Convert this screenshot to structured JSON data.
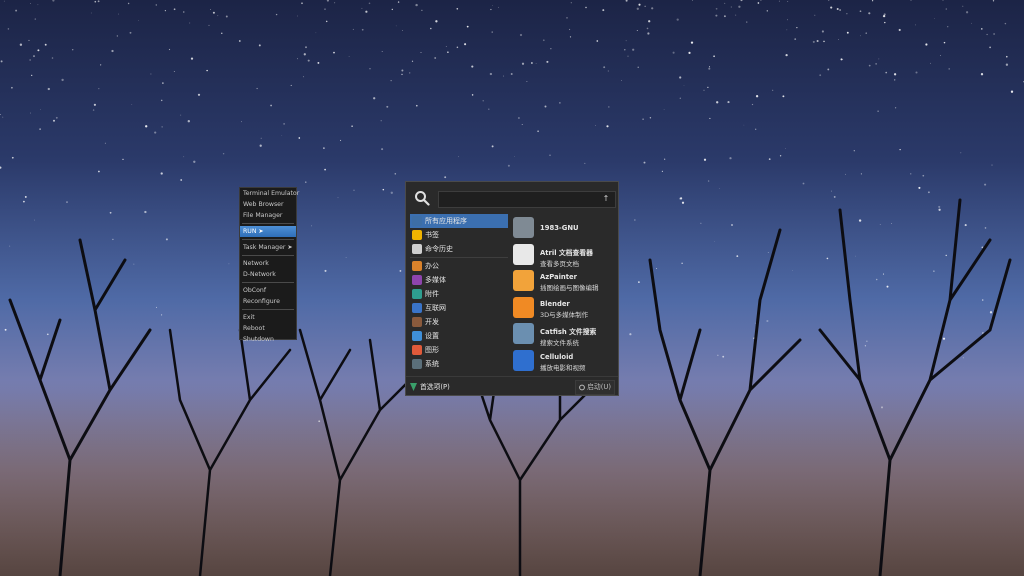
{
  "openbox_menu": {
    "items": [
      {
        "label": "Terminal Emulator"
      },
      {
        "label": "Web Browser"
      },
      {
        "label": "File Manager"
      },
      {
        "sep": true
      },
      {
        "label": "RUN ➤",
        "active": true
      },
      {
        "sep": true
      },
      {
        "label": "Task Manager ➤"
      },
      {
        "sep": true
      },
      {
        "label": "Network"
      },
      {
        "label": "D-Network"
      },
      {
        "sep": true
      },
      {
        "label": "ObConf"
      },
      {
        "label": "Reconfigure"
      },
      {
        "sep": true
      },
      {
        "label": "Exit"
      },
      {
        "label": "Reboot"
      },
      {
        "label": "Shutdown"
      }
    ]
  },
  "app_menu": {
    "search": {
      "value": "",
      "placeholder": "",
      "clear_icon": "clear-icon"
    },
    "categories": [
      {
        "label": "所有应用程序",
        "icon": "all-apps-icon",
        "color": "#3d6ea6",
        "active": true
      },
      {
        "label": "书签",
        "icon": "star-icon",
        "color": "#f0b400"
      },
      {
        "label": "命令历史",
        "icon": "history-icon",
        "color": "#cfcfcf"
      },
      {
        "sep": true
      },
      {
        "label": "办公",
        "icon": "office-icon",
        "color": "#d9822b"
      },
      {
        "label": "多媒体",
        "icon": "multimedia-icon",
        "color": "#8e44ad"
      },
      {
        "label": "附件",
        "icon": "accessories-icon",
        "color": "#2e9e8f"
      },
      {
        "label": "互联网",
        "icon": "internet-icon",
        "color": "#3a74c8"
      },
      {
        "label": "开发",
        "icon": "development-icon",
        "color": "#8a5a3c"
      },
      {
        "label": "设置",
        "icon": "settings-icon",
        "color": "#3f8fd8"
      },
      {
        "label": "图形",
        "icon": "graphics-icon",
        "color": "#e05a3a"
      },
      {
        "label": "系统",
        "icon": "system-icon",
        "color": "#5b6f7a"
      }
    ],
    "apps": [
      {
        "name": "1983-GNU",
        "desc": "",
        "icon": "gnu-icon",
        "color": "#7f8a94"
      },
      {
        "name": "Atril 文档查看器",
        "desc": "查看多页文档",
        "icon": "document-viewer-icon",
        "color": "#e8e8e8"
      },
      {
        "name": "AzPainter",
        "desc": "插图绘画与图像编辑",
        "icon": "paint-icon",
        "color": "#f2a33a"
      },
      {
        "name": "Blender",
        "desc": "3D与多媒体制作",
        "icon": "blender-icon",
        "color": "#f08a24"
      },
      {
        "name": "Catfish 文件搜索",
        "desc": "搜索文件系统",
        "icon": "catfish-icon",
        "color": "#6b8fb0"
      },
      {
        "name": "Celluloid",
        "desc": "播放电影和视频",
        "icon": "video-player-icon",
        "color": "#2f6fcf"
      }
    ],
    "footer": {
      "preferences": "首选项(P)",
      "launch": "启动(U)"
    }
  }
}
